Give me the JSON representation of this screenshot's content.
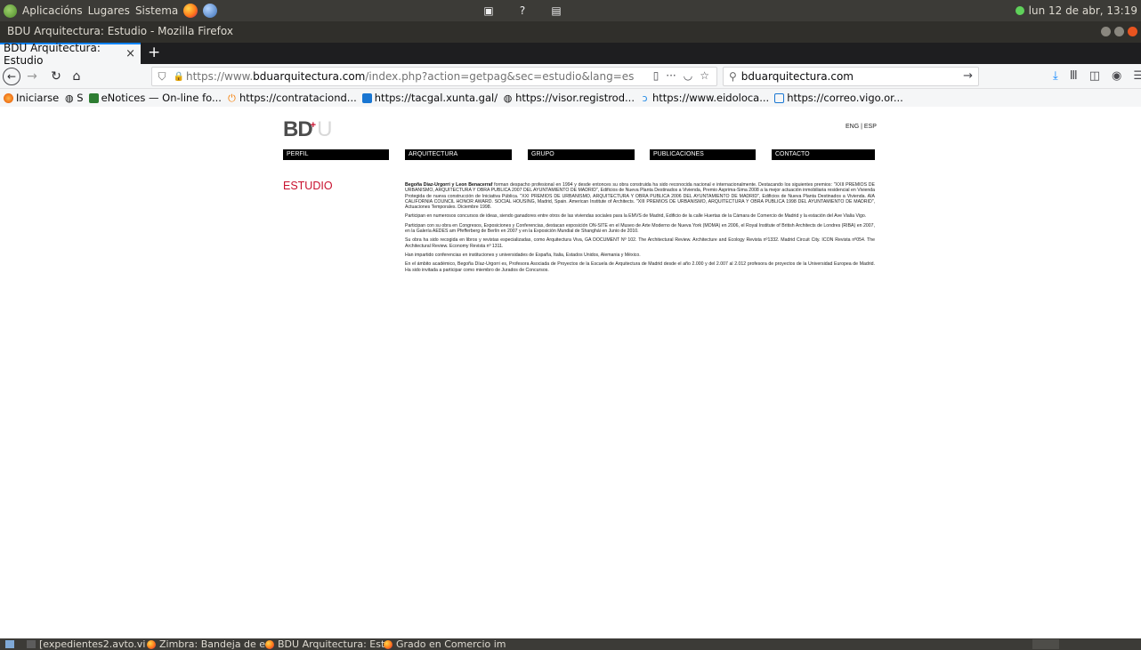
{
  "os_panel": {
    "menu_apps": "Aplicacións",
    "menu_places": "Lugares",
    "menu_system": "Sistema",
    "clock": "lun 12 de abr, 13:19"
  },
  "window": {
    "title": "BDU Arquitectura: Estudio - Mozilla Firefox"
  },
  "tabs": [
    {
      "label": "BDU Arquitectura: Estudio",
      "close": "×"
    }
  ],
  "new_tab": "+",
  "navigation": {
    "url_prefix": "https://www.",
    "url_domain": "bduarquitectura.com",
    "url_path": "/index.php?action=getpag&sec=estudio&lang=es",
    "page_actions": "···",
    "search_value": "bduarquitectura.com"
  },
  "bookmarks": [
    {
      "label": "Iniciarse",
      "icon": "firefox-icon"
    },
    {
      "label": "S",
      "icon": "globe-icon"
    },
    {
      "label": "eNotices — On-line fo...",
      "icon": "enotices-icon"
    },
    {
      "label": "https://contrataciond...",
      "icon": "power-icon"
    },
    {
      "label": "https://tacgal.xunta.gal/",
      "icon": "xunta-icon"
    },
    {
      "label": "https://visor.registrod...",
      "icon": "globe-icon"
    },
    {
      "label": "https://www.eidoloca...",
      "icon": "eidoloca-icon"
    },
    {
      "label": "https://correo.vigo.or...",
      "icon": "mail-icon"
    }
  ],
  "site": {
    "logo_main": "BD",
    "logo_light": "U",
    "logo_mark": "+",
    "lang_switch": "ENG | ESP",
    "menu": [
      "PERFIL",
      "ARQUITECTURA",
      "GRUPO",
      "PUBLICACIONES",
      "CONTACTO"
    ],
    "section_title": "ESTUDIO",
    "paragraphs": [
      {
        "lead": "Begoña Díaz-Urgorri y Leon Benacerraf",
        "text": " forman despacho profesional en 1994 y desde entonces su obra construida ha sido reconocida nacional e internacionalmente. Destacando los siguientes premios: \"XXII PREMIOS DE URBANISMO, ARQUITECTURA Y OBRA PUBLICA 2007 DEL AYUNTAMIENTO DE MADRID\", Edificios de Nueva Planta Destinados a Vivienda, Premio Asprima-Sima 2008 a la mejor actuación inmobiliaria residencial en Vivienda Protegida de nueva construcción de Iniciativa Pública. \"XXI PREMIOS DE URBANISMO, ARQUITECTURA Y OBRA PUBLICA 2006 DEL AYUNTAMIENTO DE MADRID\", Edificios de Nueva Planta Destinados a Vivienda. AIA CALIFORNIA COUNCIL HONOR AWARD. SOCIAL HOUSING, Madrid, Spain. American Institute of Architects. \"XIII PREMIOS DE URBANISMO, ARQUITECTURA Y OBRA PUBLICA 1998 DEL AYUNTAMIENTO DE MADRID\", Actuaciones Temporales. Diciembre 1998."
      },
      {
        "lead": "",
        "text": "Participan en numerosos concursos de ideas, siendo ganadores entre otros de las viviendas sociales para la EMVS de Madrid, Edificio de la calle Huertas de la Cámara de Comercio de Madrid y la estación del Ave Vialia Vigo."
      },
      {
        "lead": "",
        "text": "Participan con su obra en Congresos, Exposiciones y Conferencias, destacan exposición ON-SITE en el Museo de Arte Moderno de Nueva York (MOMA) en 2006, el Royal Institute of British Architects de Londres (RIBA) en 2007, en la Galería AEDES am Pfefferberg de Berlín en 2007 y en la Exposición Mundial de Shanghái en Junio de 2010."
      },
      {
        "lead": "",
        "text": "Su obra ha sido recogida en libros y revistas especializadas, como Arquitectura Viva, GA DOCUMENT Nº 102. The Architectural Review. Architecture and Ecology Revista nº1332. Madrid Circuit City. ICON Revista nº054. The Architectural Review. Economy Revista nº 1311."
      },
      {
        "lead": "",
        "text": "Han impartido conferencias en instituciones y universidades de España, Italia, Estados Unidos, Alemania y México."
      },
      {
        "lead": "",
        "text": "En el ámbito académico, Begoña Díaz-Urgorri es, Profesora Asociada de Proyectos de la Escuela de Arquitectura de Madrid desde el año 2.000 y del 2.007 al 2.012 profesora de proyectos de la Universidad Europea de Madrid. Ha sido invitada a participar como miembro de Jurados de Concursos."
      }
    ]
  },
  "taskbar": [
    {
      "label": "[expedientes2.avto.vi",
      "icon": "terminal-icon"
    },
    {
      "label": "Zimbra: Bandeja de en",
      "icon": "firefox-icon"
    },
    {
      "label": "BDU Arquitectura: Est",
      "icon": "firefox-icon"
    },
    {
      "label": "Grado en Comercio im",
      "icon": "firefox-icon"
    }
  ],
  "colors": {
    "accent_red": "#c8102e",
    "panel_bg": "#3c3b37",
    "tab_highlight": "#0a84ff"
  }
}
